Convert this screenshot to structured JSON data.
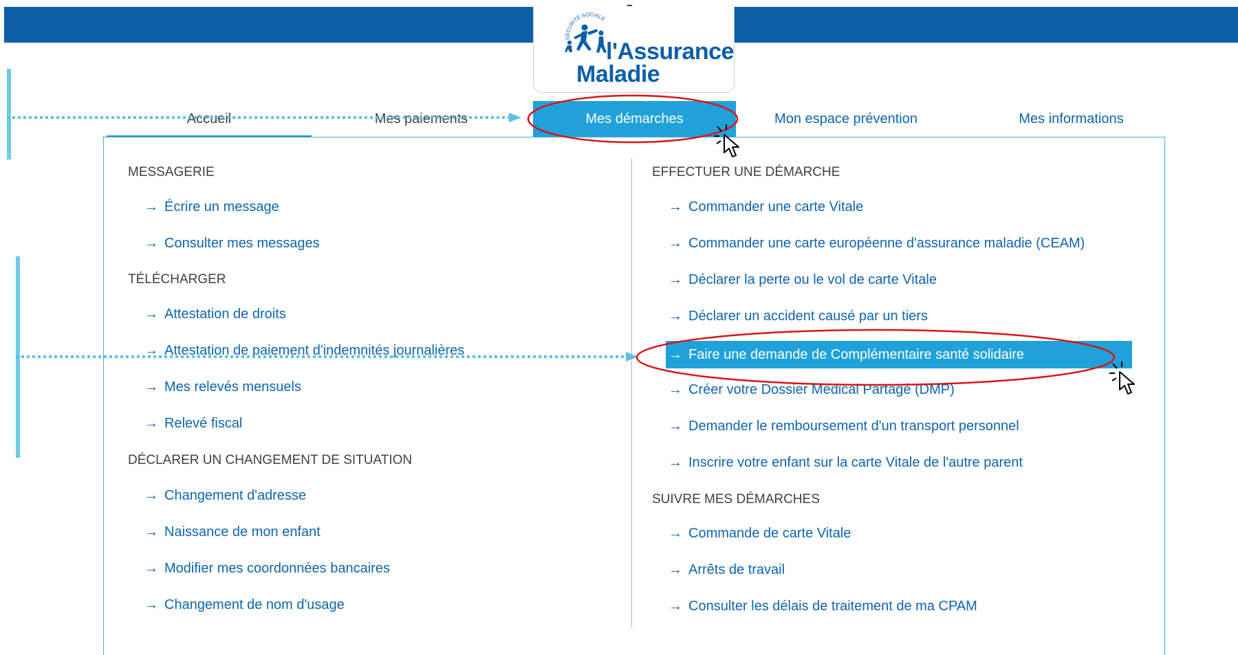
{
  "logo": {
    "badge_text": "SÉCURITÉ SOCIALE",
    "line1": "l'Assurance",
    "line2": "Maladie"
  },
  "nav": {
    "tabs": [
      {
        "label": "Accueil"
      },
      {
        "label": "Mes paiements"
      },
      {
        "label": "Mes démarches"
      },
      {
        "label": "Mon espace prévention"
      },
      {
        "label": "Mes informations"
      }
    ]
  },
  "menu": {
    "left": {
      "messagerie": {
        "title": "MESSAGERIE",
        "links": [
          "Écrire un message",
          "Consulter mes messages"
        ]
      },
      "telecharger": {
        "title": "TÉLÉCHARGER",
        "links": [
          "Attestation de droits",
          "Attestation de paiement d'indemnités journalières",
          "Mes relevés mensuels",
          "Relevé fiscal"
        ]
      },
      "changement": {
        "title": "DÉCLARER UN CHANGEMENT DE SITUATION",
        "links": [
          "Changement d'adresse",
          "Naissance de mon enfant",
          "Modifier mes coordonnées bancaires",
          "Changement de nom d'usage"
        ]
      }
    },
    "right": {
      "effectuer": {
        "title": "EFFECTUER UNE DÉMARCHE",
        "links": [
          "Commander une carte Vitale",
          "Commander une carte européenne d'assurance maladie (CEAM)",
          "Déclarer la perte ou le vol de carte Vitale",
          "Déclarer un accident causé par un tiers",
          "Faire une demande de Complémentaire santé solidaire",
          "Créer votre Dossier Médical Partagé (DMP)",
          "Demander le remboursement d'un transport personnel",
          "Inscrire votre enfant sur la carte Vitale de l'autre parent"
        ]
      },
      "suivre": {
        "title": "SUIVRE MES DÉMARCHES",
        "links": [
          "Commande de carte Vitale",
          "Arrêts de travail",
          "Consulter les délais de traitement de ma CPAM"
        ]
      }
    }
  },
  "colors": {
    "header_blue": "#0c5ea9",
    "active_blue": "#21a1d9",
    "link_blue": "#0d65b0",
    "annotation_red": "#d9141a",
    "annotation_dotted": "#5cc2e3"
  }
}
